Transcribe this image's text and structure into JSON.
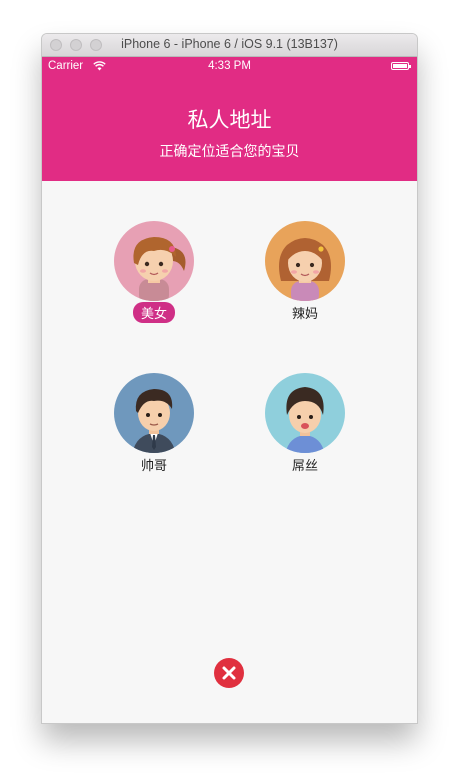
{
  "window": {
    "title": "iPhone 6 - iPhone 6 / iOS 9.1 (13B137)"
  },
  "status_bar": {
    "carrier": "Carrier",
    "time": "4:33 PM"
  },
  "header": {
    "title": "私人地址",
    "subtitle": "正确定位适合您的宝贝",
    "background": "#e12c84"
  },
  "avatars": [
    {
      "label": "美女",
      "selected": true,
      "bg": "#e7a0b4",
      "icon": "woman-ponytail-avatar-icon"
    },
    {
      "label": "辣妈",
      "selected": false,
      "bg": "#e8a35a",
      "icon": "woman-curly-hair-avatar-icon"
    },
    {
      "label": "帅哥",
      "selected": false,
      "bg": "#6f98bd",
      "icon": "man-suit-avatar-icon"
    },
    {
      "label": "屌丝",
      "selected": false,
      "bg": "#8fcfdc",
      "icon": "boy-casual-avatar-icon"
    }
  ],
  "close": {
    "icon": "close-icon",
    "color": "#e0303f"
  }
}
